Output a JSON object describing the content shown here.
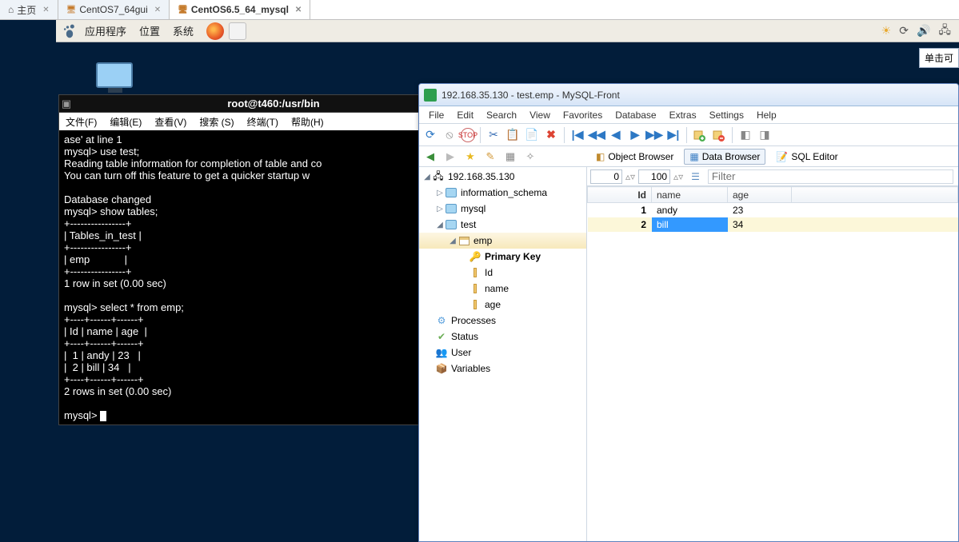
{
  "vm_tabs": [
    {
      "label": "主页",
      "icon": "house"
    },
    {
      "label": "CentOS7_64gui",
      "icon": "screen"
    },
    {
      "label": "CentOS6.5_64_mysql",
      "icon": "screen",
      "active": true
    }
  ],
  "gnome": {
    "apps": "应用程序",
    "places": "位置",
    "system": "系统"
  },
  "click_me": "单击可",
  "terminal": {
    "title": "root@t460:/usr/bin",
    "menu": {
      "file": "文件(F)",
      "edit": "编辑(E)",
      "view": "查看(V)",
      "search": "搜索 (S)",
      "terminal": "终端(T)",
      "help": "帮助(H)"
    },
    "body": "ase' at line 1\nmysql> use test;\nReading table information for completion of table and co\nYou can turn off this feature to get a quicker startup w\n\nDatabase changed\nmysql> show tables;\n+----------------+\n| Tables_in_test |\n+----------------+\n| emp            |\n+----------------+\n1 row in set (0.00 sec)\n\nmysql> select * from emp;\n+----+------+------+\n| Id | name | age  |\n+----+------+------+\n|  1 | andy | 23   |\n|  2 | bill | 34   |\n+----+------+------+\n2 rows in set (0.00 sec)\n\nmysql> "
  },
  "app": {
    "title": "192.168.35.130 - test.emp - MySQL-Front",
    "menu": {
      "file": "File",
      "edit": "Edit",
      "search": "Search",
      "view": "View",
      "favorites": "Favorites",
      "database": "Database",
      "extras": "Extras",
      "settings": "Settings",
      "help": "Help"
    },
    "views": {
      "object": "Object Browser",
      "data": "Data Browser",
      "sql": "SQL Editor"
    },
    "nav": {
      "from": "0",
      "to": "100",
      "filter_placeholder": "Filter"
    },
    "tree": {
      "host": "192.168.35.130",
      "dbs": [
        "information_schema",
        "mysql",
        "test"
      ],
      "table": "emp",
      "pk": "Primary Key",
      "cols": [
        "Id",
        "name",
        "age"
      ],
      "processes": "Processes",
      "status": "Status",
      "user": "User",
      "variables": "Variables"
    },
    "grid": {
      "headers": {
        "id": "Id",
        "name": "name",
        "age": "age"
      },
      "rows": [
        {
          "id": "1",
          "name": "andy",
          "age": "23"
        },
        {
          "id": "2",
          "name": "bill",
          "age": "34",
          "selected": true
        }
      ]
    }
  }
}
